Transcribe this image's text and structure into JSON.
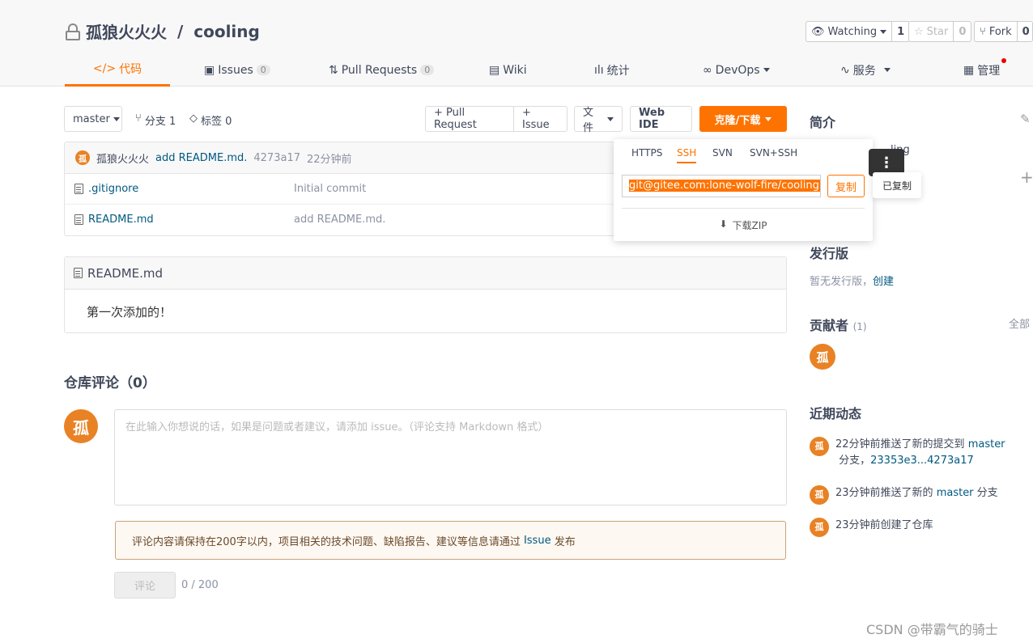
{
  "repo": {
    "owner": "孤狼火火火",
    "sep": " / ",
    "name": "cooling"
  },
  "header_buttons": {
    "watching_label": "Watching",
    "watching_count": "1",
    "star_label": "Star",
    "star_count": "0",
    "fork_label": "Fork",
    "fork_count": "0"
  },
  "tabs": {
    "code": "代码",
    "issues": "Issues",
    "issues_count": "0",
    "pulls": "Pull Requests",
    "pulls_count": "0",
    "wiki": "Wiki",
    "stats": "统计",
    "devops": "DevOps",
    "services": "服务",
    "manage": "管理"
  },
  "toolbar": {
    "branch": "master",
    "branches": "分支 1",
    "tags": "标签 0",
    "pull_request": "+ Pull Request",
    "issue": "+ Issue",
    "file": "文件",
    "web_ide": "Web IDE",
    "clone": "克隆/下载"
  },
  "commit": {
    "avatar": "孤",
    "author": "孤狼火火火",
    "message": "add README.md.",
    "hash": "4273a17",
    "time": "22分钟前"
  },
  "files": [
    {
      "name": ".gitignore",
      "message": "Initial commit"
    },
    {
      "name": "README.md",
      "message": "add README.md."
    }
  ],
  "readme": {
    "title": "README.md",
    "content": "第一次添加的！"
  },
  "comments": {
    "title": "仓库评论（0）",
    "avatar": "孤",
    "placeholder": "在此输入你想说的话，如果是问题或者建议，请添加 issue。（评论支持 Markdown 格式）",
    "notice_prefix": "评论内容请保持在200字以内，项目相关的技术问题、缺陷报告、建议等信息请通过 ",
    "notice_link": "Issue",
    "notice_suffix": " 发布",
    "submit": "评论",
    "counter": "0 / 200"
  },
  "clone_dropdown": {
    "tabs": [
      "HTTPS",
      "SSH",
      "SVN",
      "SVN+SSH"
    ],
    "active_tab": "SSH",
    "url": "git@gitee.com:lone-wolf-fire/cooling.git",
    "copy": "复制",
    "download_zip": "下载ZIP",
    "more": "⋮",
    "copied": "已复制"
  },
  "sidebar": {
    "intro_title": "简介",
    "intro_fragment": "ling",
    "release_title": "发行版",
    "release_text": "暂无发行版，",
    "release_link": "创建",
    "contributors_title": "贡献者",
    "contributors_count": "(1)",
    "contributors_all": "全部",
    "contributor_avatar": "孤",
    "activity_title": "近期动态",
    "activity": [
      {
        "avatar": "孤",
        "text1": "22分钟前推送了新的提交到 ",
        "link1": "master",
        "text2": " 分支，",
        "link2": "23353e3...4273a17"
      },
      {
        "avatar": "孤",
        "text1": "23分钟前推送了新的 ",
        "link1": "master",
        "text2": " 分支"
      },
      {
        "avatar": "孤",
        "text1": "23分钟前创建了仓库"
      }
    ]
  },
  "watermark": "CSDN @带霸气的骑士",
  "colors": {
    "accent": "#fe7300",
    "link": "#005980",
    "avatar": "#e88224"
  }
}
